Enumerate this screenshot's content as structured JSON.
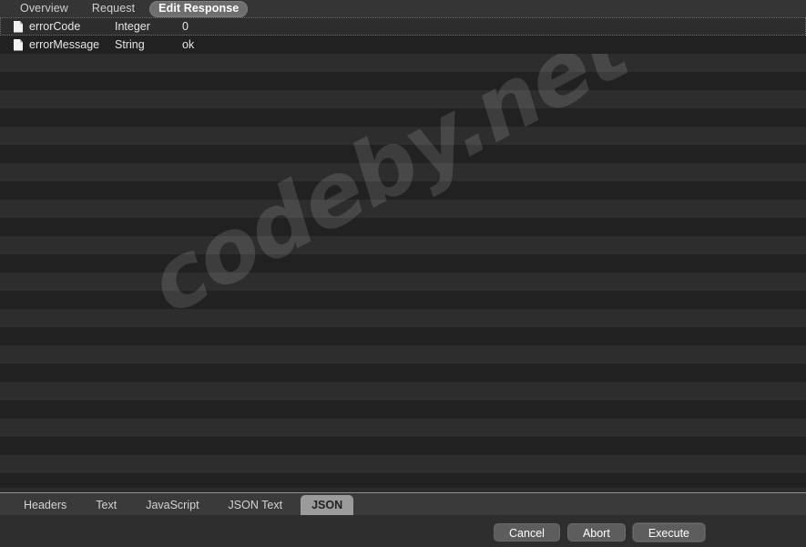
{
  "window": {
    "title": "Edit Response"
  },
  "top_tabs": [
    {
      "label": "Overview",
      "selected": false
    },
    {
      "label": "Request",
      "selected": false
    },
    {
      "label": "Edit Response",
      "selected": true
    }
  ],
  "table": {
    "rows": [
      {
        "icon": "document-icon",
        "name": "errorCode",
        "type": "Integer",
        "value": "0",
        "focused": true
      },
      {
        "icon": "document-icon",
        "name": "errorMessage",
        "type": "String",
        "value": "ok",
        "focused": false
      }
    ]
  },
  "watermark": {
    "text": "codeby.net"
  },
  "bottom_tabs": [
    {
      "label": "Headers",
      "selected": false
    },
    {
      "label": "Text",
      "selected": false
    },
    {
      "label": "JavaScript",
      "selected": false
    },
    {
      "label": "JSON Text",
      "selected": false
    },
    {
      "label": "JSON",
      "selected": true
    }
  ],
  "footer": {
    "buttons": [
      {
        "label": "Cancel",
        "focused": false
      },
      {
        "label": "Abort",
        "focused": false
      },
      {
        "label": "Execute",
        "focused": true
      }
    ]
  },
  "colors": {
    "window_bg": "#2b2b2b",
    "top_bar_bg": "#353535",
    "stripe_light": "#2d2d2d",
    "stripe_dark": "#212121",
    "selected_tab_bg": "#6e6e6e",
    "bottom_tab_bar_bg": "#3a3a3a",
    "bottom_selected_tab_bg": "#9b9b9b",
    "footer_bg": "#2e2e2e",
    "button_bg": "#5d5d5d",
    "text": "#e6e6e6",
    "divider": "#8f8f8f"
  }
}
